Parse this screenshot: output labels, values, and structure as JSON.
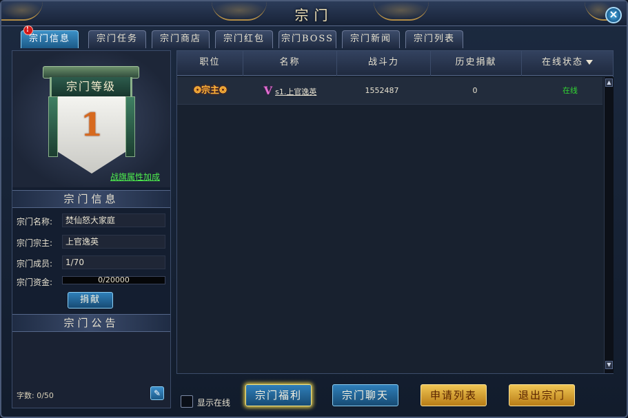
{
  "window": {
    "title": "宗门"
  },
  "tabs": [
    {
      "label": "宗门信息",
      "active": true,
      "alert": "!"
    },
    {
      "label": "宗门任务"
    },
    {
      "label": "宗门商店"
    },
    {
      "label": "宗门红包"
    },
    {
      "label": "宗门BOSS"
    },
    {
      "label": "宗门新闻"
    },
    {
      "label": "宗门列表"
    }
  ],
  "banner": {
    "title": "宗门等级",
    "level": "1",
    "attr_link": "战旗属性加成"
  },
  "info": {
    "header": "宗门信息",
    "name_label": "宗门名称:",
    "name_value": "焚仙怒大家庭",
    "leader_label": "宗门宗主:",
    "leader_value": "上官逸英",
    "members_label": "宗门成员:",
    "members_value": "1/70",
    "funds_label": "宗门资金:",
    "funds_value": "0/20000",
    "funds_fraction": 0,
    "donate_button": "捐献"
  },
  "notice": {
    "header": "宗门公告",
    "char_count": "字数: 0/50",
    "edit_icon": "pencil-icon"
  },
  "table": {
    "columns": [
      "职位",
      "名称",
      "战斗力",
      "历史捐献",
      "在线状态"
    ],
    "rows": [
      {
        "position": "宗主",
        "vip": "V",
        "name": "s1.上官逸英",
        "power": "1552487",
        "donation": "0",
        "status": "在线"
      }
    ]
  },
  "bottom": {
    "show_online_label": "显示在线",
    "buttons": [
      "宗门福利",
      "宗门聊天",
      "申请列表",
      "退出宗门"
    ]
  },
  "colors": {
    "accent_blue": "#2f7fb9",
    "gold": "#f0c654",
    "online_green": "#32d832",
    "link_green": "#4ef04e"
  }
}
